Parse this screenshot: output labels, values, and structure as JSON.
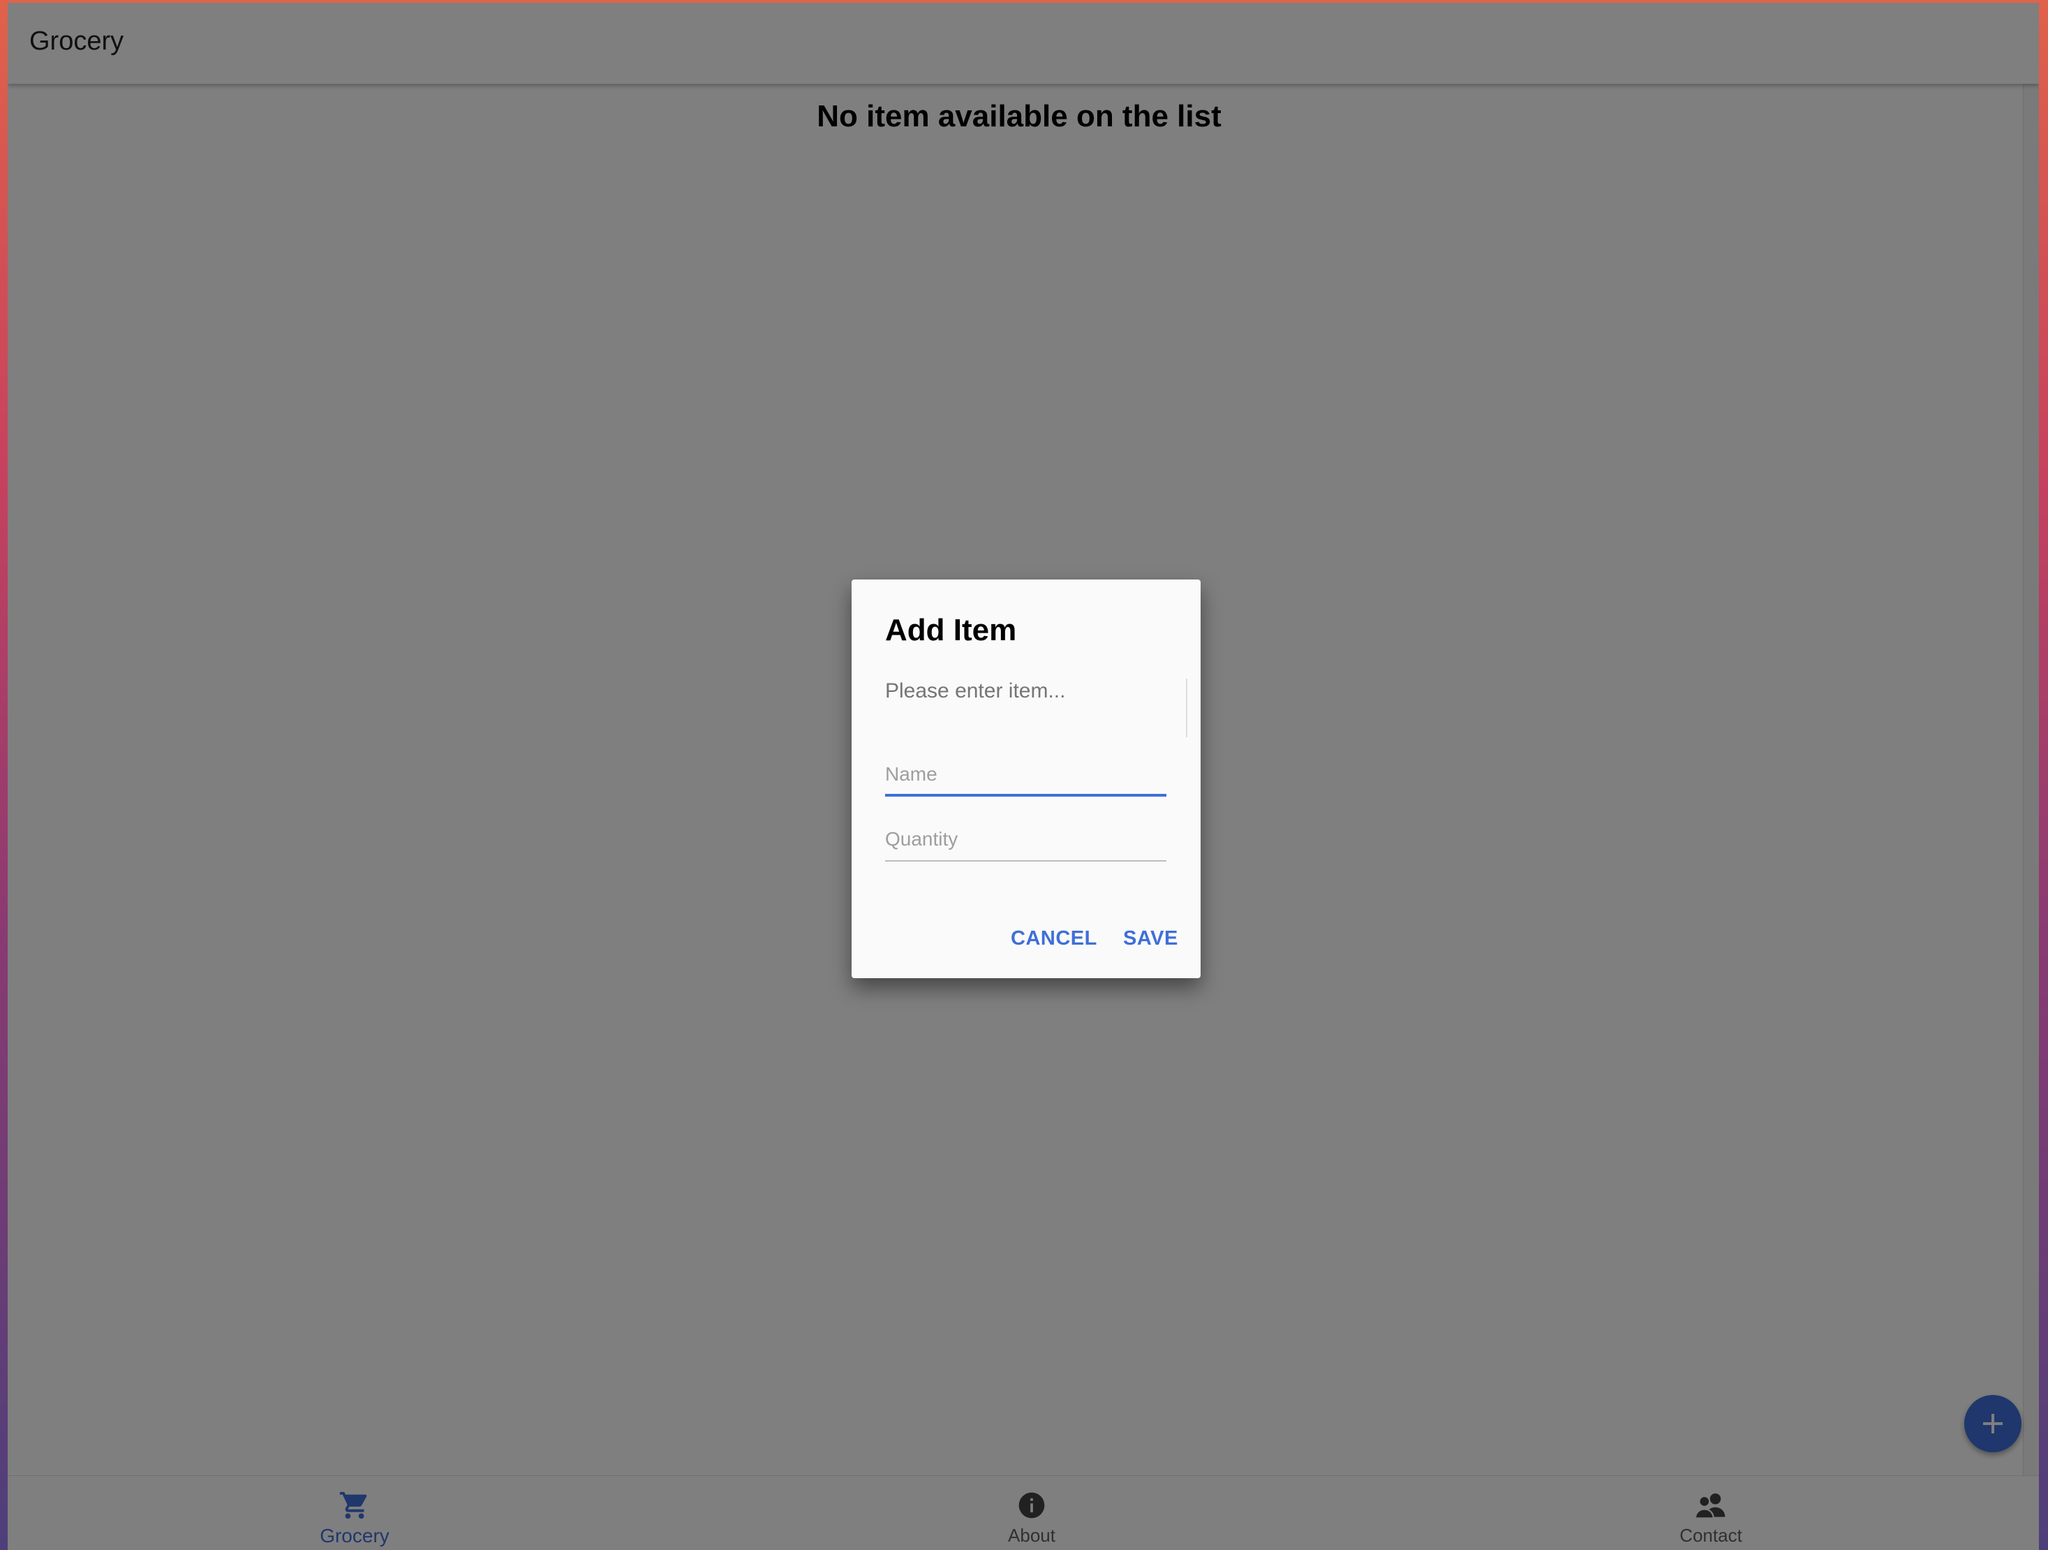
{
  "app_bar": {
    "title": "Grocery"
  },
  "main": {
    "empty_message": "No item available on the list"
  },
  "fab": {
    "icon": "add-icon"
  },
  "bottom_nav": {
    "items": [
      {
        "label": "Grocery",
        "icon": "cart-icon",
        "active": true
      },
      {
        "label": "About",
        "icon": "info-icon",
        "active": false
      },
      {
        "label": "Contact",
        "icon": "contacts-icon",
        "active": false
      }
    ]
  },
  "dialog": {
    "title": "Add Item",
    "text": "Please enter item...",
    "name_field": {
      "placeholder": "Name",
      "value": ""
    },
    "quantity_field": {
      "placeholder": "Quantity",
      "value": ""
    },
    "cancel_label": "CANCEL",
    "save_label": "SAVE"
  },
  "colors": {
    "accent": "#3f6fd8",
    "scrim": "rgba(0,0,0,0.5)"
  }
}
